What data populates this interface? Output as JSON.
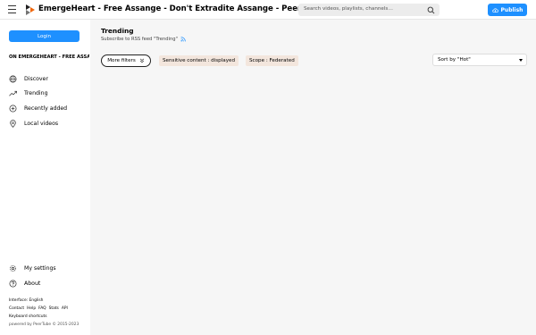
{
  "header": {
    "title": "EmergeHeart - Free Assange - Don't Extradite Assange - PeerTube",
    "search_placeholder": "Search videos, playlists, channels…",
    "publish_label": "Publish"
  },
  "sidebar": {
    "login_label": "Login",
    "instance_heading": "ON EMERGEHEART - FREE ASSANGE - DON'T EXTRADITE ASSANGE",
    "nav": [
      {
        "label": "Discover",
        "icon": "globe-icon"
      },
      {
        "label": "Trending",
        "icon": "trending-icon"
      },
      {
        "label": "Recently added",
        "icon": "plus-circle-icon"
      },
      {
        "label": "Local videos",
        "icon": "location-pin-icon"
      }
    ],
    "bottom_nav": [
      {
        "label": "My settings",
        "icon": "gear-icon"
      },
      {
        "label": "About",
        "icon": "help-icon"
      }
    ],
    "footer": {
      "interface": "Interface: English",
      "links": [
        "Contact",
        "Help",
        "FAQ",
        "Stats",
        "API"
      ],
      "shortcuts": "Keyboard shortcuts",
      "powered": "powered by PeerTube © 2015-2023"
    }
  },
  "main": {
    "title": "Trending",
    "rss_text": "Subscribe to RSS feed \"Trending\"",
    "more_filters_label": "More filters",
    "filter_pills": [
      "Sensitive content : displayed",
      "Scope : Federated"
    ],
    "sort_label": "Sort by \"Hot\""
  },
  "colors": {
    "accent": "#1e90ff",
    "pill_bg": "#f3e6dd",
    "main_bg": "#f6f6f6",
    "logo_orange": "#f1680d",
    "logo_dark": "#211f20"
  }
}
